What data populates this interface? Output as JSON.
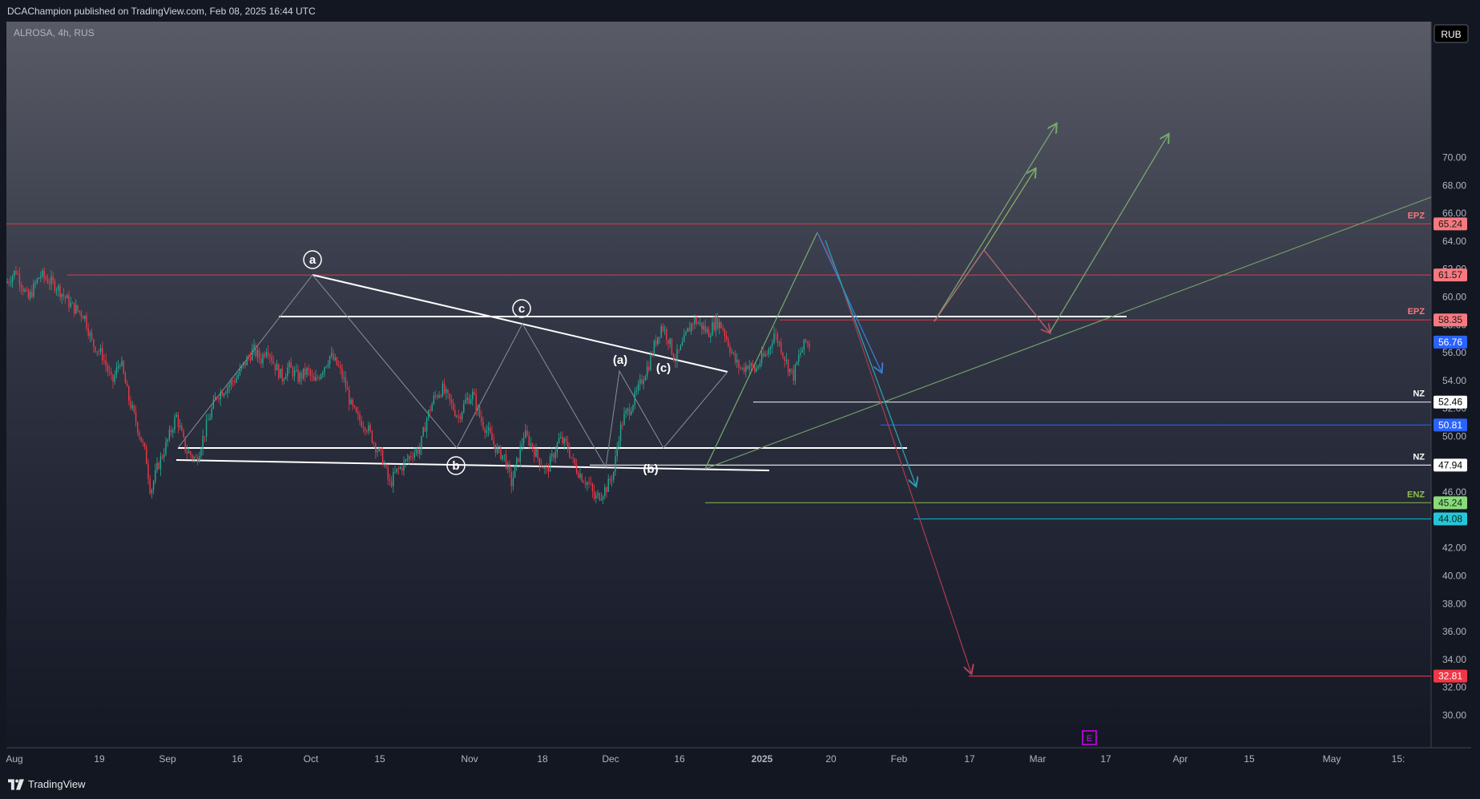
{
  "header": {
    "published": "DCAChampion published on TradingView.com, Feb 08, 2025 16:44 UTC"
  },
  "footer": {
    "brand": "TradingView",
    "logo_icon": "tradingview-logo-icon"
  },
  "chart_data": {
    "type": "candlestick",
    "symbol_label": "ALROSA, 4h, RUS",
    "currency": "RUB",
    "ylim": [
      28.6,
      73.0
    ],
    "y_ticks": [
      "30.00",
      "32.00",
      "34.00",
      "36.00",
      "38.00",
      "40.00",
      "42.00",
      "44.00",
      "46.00",
      "48.00",
      "50.00",
      "52.00",
      "54.00",
      "56.00",
      "58.00",
      "60.00",
      "62.00",
      "64.00",
      "66.00",
      "68.00",
      "70.00"
    ],
    "x_ticks": [
      "Aug",
      "19",
      "Sep",
      "16",
      "Oct",
      "15",
      "Nov",
      "18",
      "Dec",
      "16",
      "2025",
      "20",
      "Feb",
      "17",
      "Mar",
      "17",
      "Apr",
      "15",
      "May",
      "15:"
    ],
    "price_path": [
      [
        8,
        61.0
      ],
      [
        20,
        61.9
      ],
      [
        35,
        59.8
      ],
      [
        50,
        61.6
      ],
      [
        70,
        60.8
      ],
      [
        90,
        59.3
      ],
      [
        105,
        58.7
      ],
      [
        115,
        56.7
      ],
      [
        128,
        55.8
      ],
      [
        140,
        53.8
      ],
      [
        150,
        55.5
      ],
      [
        160,
        52.8
      ],
      [
        170,
        51.0
      ],
      [
        182,
        48.6
      ],
      [
        188,
        46.0
      ],
      [
        196,
        47.7
      ],
      [
        208,
        49.5
      ],
      [
        220,
        51.5
      ],
      [
        232,
        49.0
      ],
      [
        245,
        48.3
      ],
      [
        258,
        50.8
      ],
      [
        270,
        52.9
      ],
      [
        282,
        53.5
      ],
      [
        295,
        54.2
      ],
      [
        305,
        55.2
      ],
      [
        316,
        56.2
      ],
      [
        326,
        55.5
      ],
      [
        333,
        56.5
      ],
      [
        342,
        55.2
      ],
      [
        352,
        54.2
      ],
      [
        360,
        55.0
      ],
      [
        372,
        54.2
      ],
      [
        384,
        54.7
      ],
      [
        392,
        53.8
      ],
      [
        402,
        54.8
      ],
      [
        412,
        55.8
      ],
      [
        422,
        55.0
      ],
      [
        430,
        53.9
      ],
      [
        438,
        52.2
      ],
      [
        446,
        51.3
      ],
      [
        458,
        50.7
      ],
      [
        468,
        49.4
      ],
      [
        478,
        48.3
      ],
      [
        486,
        46.5
      ],
      [
        494,
        47.4
      ],
      [
        504,
        48.0
      ],
      [
        514,
        48.8
      ],
      [
        524,
        49.1
      ],
      [
        532,
        51.2
      ],
      [
        542,
        52.8
      ],
      [
        552,
        53.4
      ],
      [
        562,
        52.4
      ],
      [
        572,
        51.4
      ],
      [
        582,
        52.6
      ],
      [
        590,
        53.0
      ],
      [
        600,
        51.2
      ],
      [
        610,
        50.2
      ],
      [
        620,
        49.0
      ],
      [
        630,
        48.5
      ],
      [
        638,
        46.6
      ],
      [
        646,
        48.3
      ],
      [
        654,
        50.2
      ],
      [
        662,
        49.5
      ],
      [
        672,
        48.4
      ],
      [
        682,
        47.5
      ],
      [
        690,
        48.6
      ],
      [
        698,
        49.8
      ],
      [
        708,
        49.3
      ],
      [
        716,
        48.0
      ],
      [
        726,
        47.1
      ],
      [
        736,
        46.5
      ],
      [
        742,
        45.5
      ],
      [
        750,
        45.9
      ],
      [
        758,
        46.4
      ],
      [
        766,
        47.5
      ],
      [
        772,
        50.0
      ],
      [
        778,
        51.3
      ],
      [
        786,
        52.0
      ],
      [
        794,
        53.0
      ],
      [
        802,
        54.2
      ],
      [
        810,
        55.2
      ],
      [
        818,
        56.8
      ],
      [
        826,
        58.0
      ],
      [
        834,
        57.0
      ],
      [
        842,
        55.5
      ],
      [
        850,
        56.3
      ],
      [
        858,
        57.5
      ],
      [
        866,
        58.4
      ],
      [
        874,
        58.0
      ],
      [
        884,
        57.4
      ],
      [
        894,
        58.3
      ],
      [
        902,
        57.8
      ],
      [
        910,
        56.5
      ],
      [
        918,
        55.3
      ],
      [
        926,
        54.8
      ],
      [
        934,
        55.2
      ],
      [
        942,
        54.7
      ],
      [
        950,
        55.5
      ],
      [
        958,
        56.0
      ],
      [
        966,
        57.4
      ],
      [
        974,
        56.5
      ],
      [
        982,
        55.2
      ],
      [
        990,
        54.3
      ],
      [
        998,
        55.9
      ],
      [
        1006,
        56.8
      ],
      [
        1012,
        56.4
      ]
    ],
    "levels": [
      {
        "price": 65.24,
        "price_label": "65.24",
        "zone": "EPZ",
        "color": "#f23645"
      },
      {
        "price": 61.57,
        "price_label": "61.57",
        "zone": "",
        "color": "#f23645"
      },
      {
        "price": 58.35,
        "price_label": "58.35",
        "zone": "EPZ",
        "color": "#f23645"
      },
      {
        "price": 56.76,
        "price_label": "56.76",
        "zone": "",
        "color": "#2962ff"
      },
      {
        "price": 52.46,
        "price_label": "52.46",
        "zone": "NZ",
        "color": "#ffffff"
      },
      {
        "price": 50.81,
        "price_label": "50.81",
        "zone": "",
        "color": "#2962ff"
      },
      {
        "price": 47.94,
        "price_label": "47.94",
        "zone": "NZ",
        "color": "#ffffff"
      },
      {
        "price": 45.24,
        "price_label": "45.24",
        "zone": "ENZ",
        "color": "#8bc34a"
      },
      {
        "price": 44.08,
        "price_label": "44.08",
        "zone": "",
        "color": "#00bcd4"
      },
      {
        "price": 32.81,
        "price_label": "32.81",
        "zone": "",
        "color": "#f23645"
      }
    ],
    "wave_labels": [
      "a",
      "b",
      "c",
      "(a)",
      "(b)",
      "(c)"
    ],
    "earnings_marker": "E"
  }
}
